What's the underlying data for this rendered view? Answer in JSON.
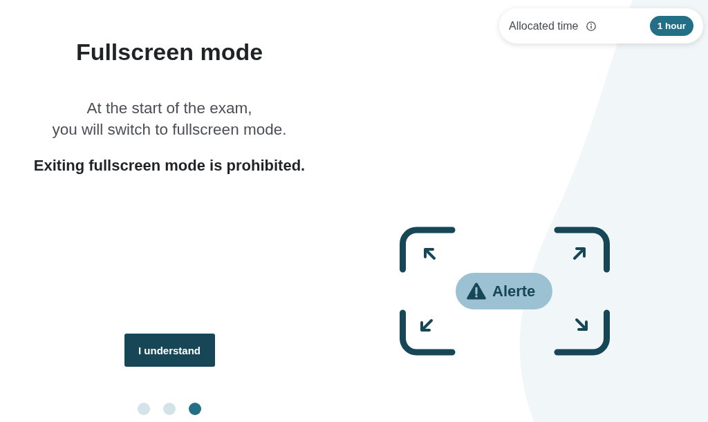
{
  "header": {
    "label": "Allocated time",
    "badge": "1 hour"
  },
  "title": "Fullscreen mode",
  "description_lines": [
    "At the start of the exam,",
    "you will switch to fullscreen mode."
  ],
  "warning": "Exiting fullscreen mode is prohibited.",
  "illustration": {
    "alert_label": "Alerte"
  },
  "button": {
    "label": "I understand"
  },
  "steps": [
    {
      "selected": false
    },
    {
      "selected": false
    },
    {
      "selected": true
    }
  ]
}
